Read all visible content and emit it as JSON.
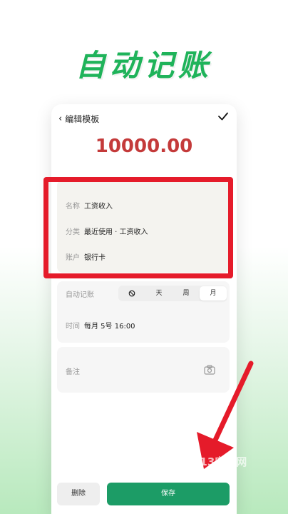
{
  "headline": "自动记账",
  "topbar": {
    "back_label": "编辑模板"
  },
  "amount": "10000.00",
  "fields": {
    "name_label": "名称",
    "name_value": "工资收入",
    "category_label": "分类",
    "category_value": "最近使用 · 工资收入",
    "account_label": "账户",
    "account_value": "银行卡"
  },
  "auto": {
    "label": "自动记账",
    "options": [
      "天",
      "周",
      "月"
    ],
    "selected": "月"
  },
  "time": {
    "label": "时间",
    "value": "每月 5号 16:00"
  },
  "note": {
    "label": "备注"
  },
  "buttons": {
    "delete": "删除",
    "save": "保存"
  },
  "watermark": "913安卓网",
  "colors": {
    "brand_green": "#1fb35a",
    "save_green": "#1c9c66",
    "amount_red": "#c43a3a",
    "highlight_red": "#e51b2a"
  }
}
